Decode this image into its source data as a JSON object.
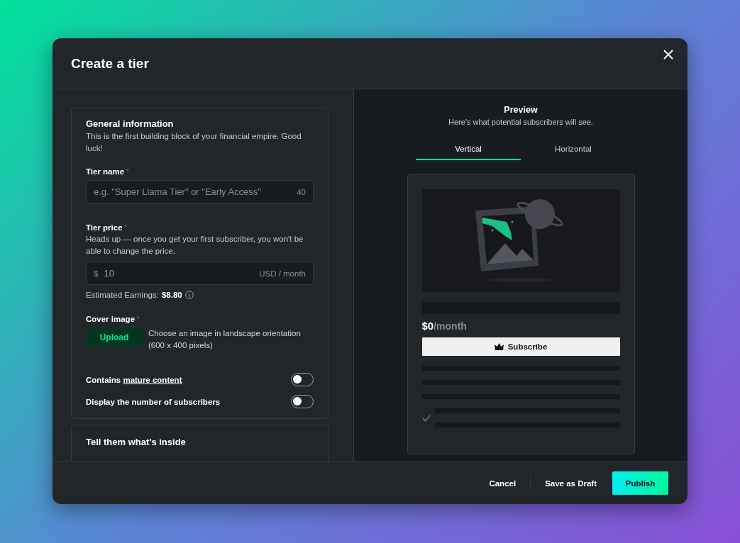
{
  "dialog": {
    "title": "Create a tier"
  },
  "general": {
    "title": "General information",
    "description": "This is the first building block of your financial empire. Good luck!",
    "tier_name": {
      "label": "Tier name",
      "mark": "*",
      "placeholder": "e.g. \"Super Llama Tier\" or \"Early Access\"",
      "counter": "40"
    },
    "tier_price": {
      "label": "Tier price",
      "mark": "*",
      "hint": "Heads up — once you get your first subscriber, you won't be able to change the price.",
      "symbol": "$",
      "value": "10",
      "unit": "USD / month"
    },
    "earnings": {
      "label": "Estimated Earnings:",
      "amount": "$8.80"
    },
    "cover": {
      "label": "Cover image",
      "mark": "*",
      "button": "Upload",
      "hint": "Choose an image in landscape orientation (600 x 400 pixels)"
    },
    "toggles": [
      {
        "label": "Contains",
        "link": "mature content",
        "on": false
      },
      {
        "label": "Display the number of subscribers",
        "on": false
      }
    ]
  },
  "inside": {
    "title": "Tell them what's inside"
  },
  "preview": {
    "title": "Preview",
    "subtitle": "Here's what potential subscribers will see.",
    "tabs": [
      {
        "label": "Vertical",
        "selected": true
      },
      {
        "label": "Horizontal",
        "selected": false
      }
    ],
    "price": "$0",
    "period": "/month",
    "subscribe": "Subscribe"
  },
  "footer": {
    "cancel": "Cancel",
    "draft": "Save as Draft",
    "publish": "Publish"
  }
}
